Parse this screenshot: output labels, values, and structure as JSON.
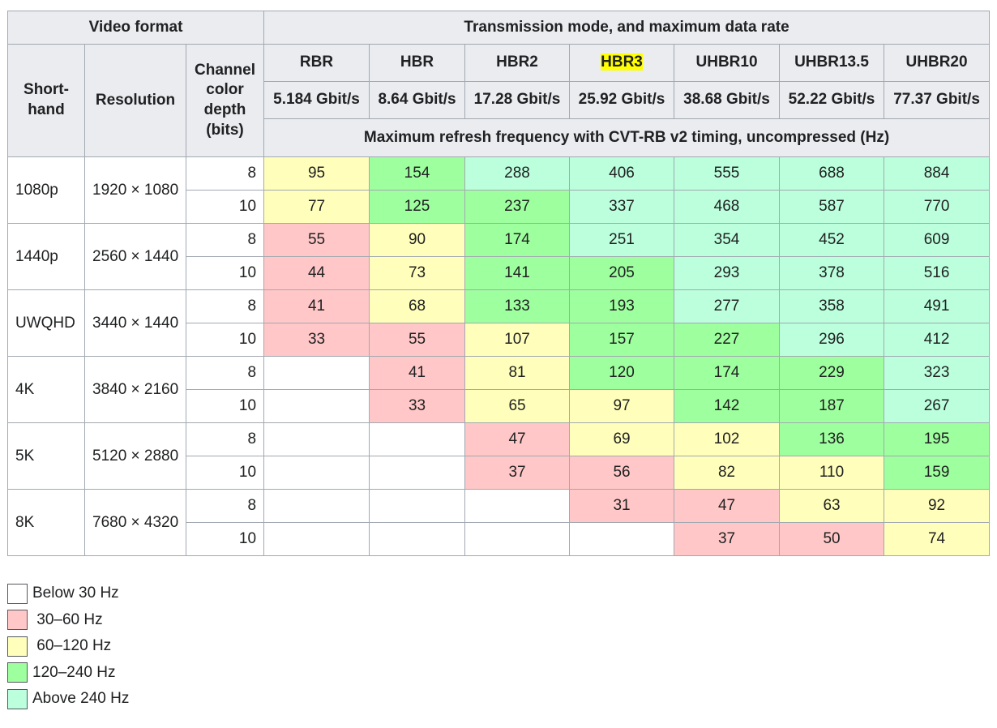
{
  "header": {
    "video_format": "Video format",
    "transmission": "Transmission mode, and maximum data rate",
    "shorthand": "Short-hand",
    "resolution": "Resolution",
    "channel_depth": "Channel color depth (bits)",
    "modes": [
      {
        "name": "RBR",
        "rate": "5.184 Gbit/s"
      },
      {
        "name": "HBR",
        "rate": "8.64 Gbit/s"
      },
      {
        "name": "HBR2",
        "rate": "17.28 Gbit/s"
      },
      {
        "name": "HBR3",
        "rate": "25.92 Gbit/s"
      },
      {
        "name": "UHBR10",
        "rate": "38.68 Gbit/s"
      },
      {
        "name": "UHBR13.5",
        "rate": "52.22 Gbit/s"
      },
      {
        "name": "UHBR20",
        "rate": "77.37 Gbit/s"
      }
    ],
    "refresh_caption": "Maximum refresh frequency with CVT-RB v2 timing, uncompressed (Hz)"
  },
  "groups": [
    {
      "short": "1080p",
      "resolution": "1920 × 1080",
      "rows": [
        {
          "depth": "8",
          "values": [
            "95",
            "154",
            "288",
            "406",
            "555",
            "688",
            "884"
          ]
        },
        {
          "depth": "10",
          "values": [
            "77",
            "125",
            "237",
            "337",
            "468",
            "587",
            "770"
          ]
        }
      ]
    },
    {
      "short": "1440p",
      "resolution": "2560 × 1440",
      "rows": [
        {
          "depth": "8",
          "values": [
            "55",
            "90",
            "174",
            "251",
            "354",
            "452",
            "609"
          ]
        },
        {
          "depth": "10",
          "values": [
            "44",
            "73",
            "141",
            "205",
            "293",
            "378",
            "516"
          ]
        }
      ]
    },
    {
      "short": "UWQHD",
      "resolution": "3440 × 1440",
      "rows": [
        {
          "depth": "8",
          "values": [
            "41",
            "68",
            "133",
            "193",
            "277",
            "358",
            "491"
          ]
        },
        {
          "depth": "10",
          "values": [
            "33",
            "55",
            "107",
            "157",
            "227",
            "296",
            "412"
          ]
        }
      ]
    },
    {
      "short": "4K",
      "resolution": "3840 × 2160",
      "rows": [
        {
          "depth": "8",
          "values": [
            "",
            "41",
            "81",
            "120",
            "174",
            "229",
            "323"
          ]
        },
        {
          "depth": "10",
          "values": [
            "",
            "33",
            "65",
            "97",
            "142",
            "187",
            "267"
          ]
        }
      ]
    },
    {
      "short": "5K",
      "resolution": "5120 × 2880",
      "rows": [
        {
          "depth": "8",
          "values": [
            "",
            "",
            "47",
            "69",
            "102",
            "136",
            "195"
          ]
        },
        {
          "depth": "10",
          "values": [
            "",
            "",
            "37",
            "56",
            "82",
            "110",
            "159"
          ]
        }
      ]
    },
    {
      "short": "8K",
      "resolution": "7680 × 4320",
      "rows": [
        {
          "depth": "8",
          "values": [
            "",
            "",
            "",
            "31",
            "47",
            "63",
            "92"
          ]
        },
        {
          "depth": "10",
          "values": [
            "",
            "",
            "",
            "",
            "37",
            "50",
            "74"
          ]
        }
      ]
    }
  ],
  "legend": [
    {
      "label": "Below 30 Hz",
      "color": "#ffffff"
    },
    {
      "label": " 30–60 Hz",
      "color": "#ffc7c7"
    },
    {
      "label": " 60–120 Hz",
      "color": "#ffffbb"
    },
    {
      "label": "120–240 Hz",
      "color": "#9eff9e"
    },
    {
      "label": "Above 240 Hz",
      "color": "#bbffdd"
    }
  ],
  "colors": {
    "below_30": "#ffffff",
    "30_60": "#ffc7c7",
    "60_120": "#ffffbb",
    "120_240": "#9eff9e",
    "above_240": "#bbffdd",
    "header_bg": "#eaecf0",
    "border": "#a2a9b1",
    "highlight": "#ffff00"
  }
}
